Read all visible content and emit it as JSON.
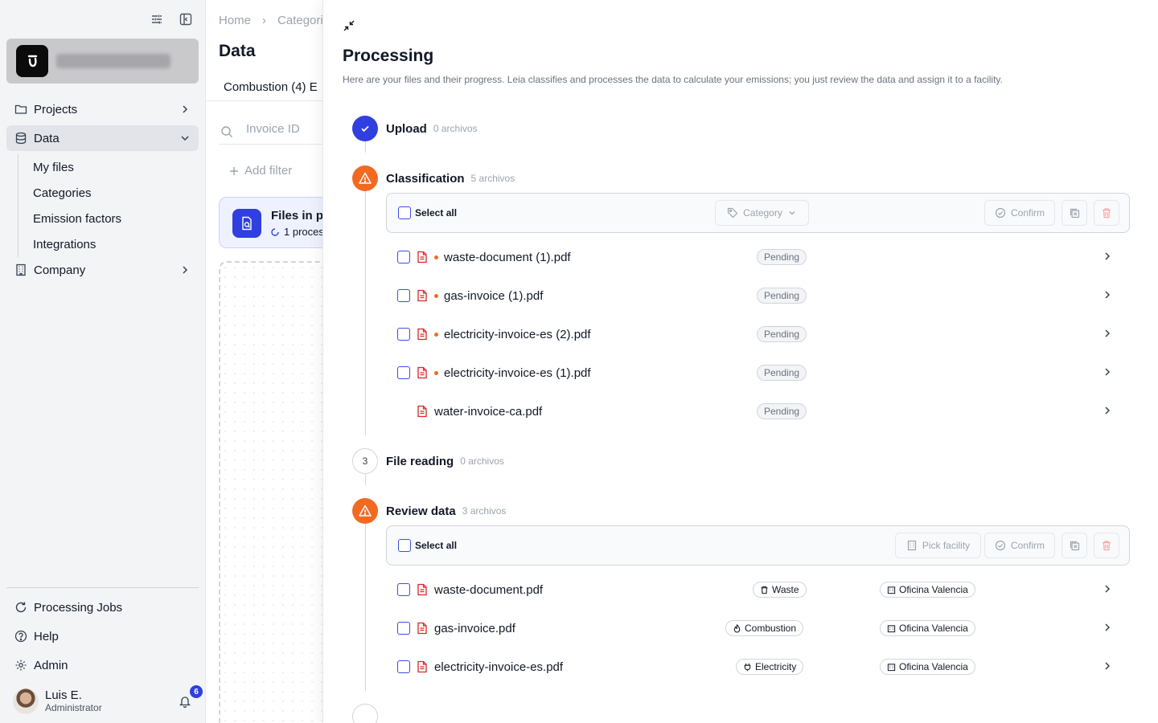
{
  "sidebar": {
    "nav": [
      {
        "label": "Projects",
        "icon": "folder-icon"
      },
      {
        "label": "Data",
        "icon": "database-icon"
      },
      {
        "label": "Company",
        "icon": "building-icon"
      }
    ],
    "data_children": [
      "My files",
      "Categories",
      "Emission factors",
      "Integrations"
    ],
    "bottom": [
      {
        "label": "Processing Jobs",
        "icon": "refresh-icon"
      },
      {
        "label": "Help",
        "icon": "help-icon"
      },
      {
        "label": "Admin",
        "icon": "gear-icon"
      }
    ],
    "user": {
      "name": "Luis E.",
      "role": "Administrator",
      "notifications": "6"
    }
  },
  "main": {
    "breadcrumbs": [
      "Home",
      "Categori"
    ],
    "title": "Data",
    "tab": "Combustion (4)  E",
    "search_placeholder": "Invoice ID",
    "add_filter": "Add filter",
    "files_card": {
      "title": "Files in pr",
      "status": "1 proces"
    }
  },
  "panel": {
    "title": "Processing",
    "description": "Here are your files and their progress. Leia classifies and processes the data to calculate your emissions; you just review the data and assign it to a facility.",
    "steps": {
      "upload": {
        "name": "Upload",
        "count": "0 archivos"
      },
      "classification": {
        "name": "Classification",
        "count": "5 archivos"
      },
      "file_reading": {
        "name": "File reading",
        "count": "0 archivos",
        "number": "3"
      },
      "review": {
        "name": "Review data",
        "count": "3 archivos"
      }
    },
    "classification_toolbar": {
      "select_all": "Select all",
      "category": "Category",
      "confirm": "Confirm"
    },
    "classification_files": [
      {
        "name": "waste-document (1).pdf",
        "status": "Pending"
      },
      {
        "name": "gas-invoice (1).pdf",
        "status": "Pending"
      },
      {
        "name": "electricity-invoice-es (2).pdf",
        "status": "Pending"
      },
      {
        "name": "electricity-invoice-es (1).pdf",
        "status": "Pending"
      },
      {
        "name": "water-invoice-ca.pdf",
        "status": "Pending"
      }
    ],
    "review_toolbar": {
      "select_all": "Select all",
      "pick_facility": "Pick facility",
      "confirm": "Confirm"
    },
    "review_files": [
      {
        "name": "waste-document.pdf",
        "category": "Waste",
        "category_icon": "trash-icon",
        "facility": "Oficina Valencia"
      },
      {
        "name": "gas-invoice.pdf",
        "category": "Combustion",
        "category_icon": "flame-icon",
        "facility": "Oficina Valencia"
      },
      {
        "name": "electricity-invoice-es.pdf",
        "category": "Electricity",
        "category_icon": "plug-icon",
        "facility": "Oficina Valencia"
      }
    ]
  },
  "colors": {
    "accent": "#2f3fe0",
    "warning": "#f26a22",
    "pdf": "#dc2626"
  }
}
